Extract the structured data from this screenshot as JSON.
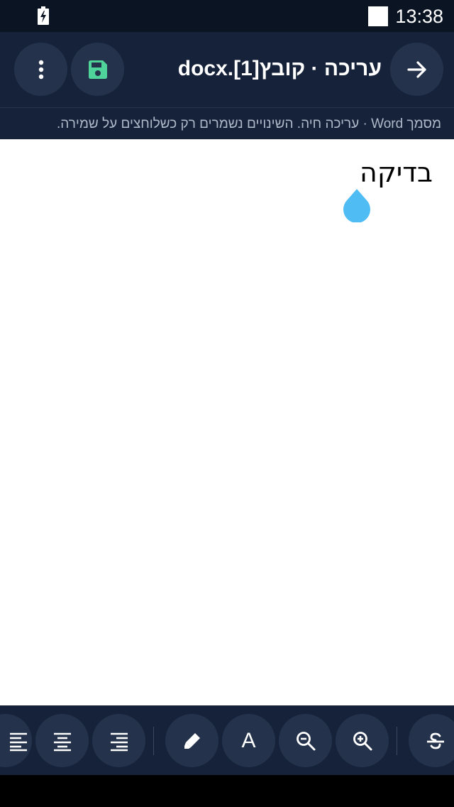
{
  "status_bar": {
    "time": "13:38",
    "battery_icon": "battery-charging-icon"
  },
  "app_bar": {
    "title": "עריכה · קובץ[1].docx",
    "back_icon": "arrow-right-icon",
    "save_icon": "save-icon",
    "menu_icon": "more-vert-icon"
  },
  "subtitle": "מסמך Word · עריכה חיה. השינויים נשמרים רק כשלוחצים על שמירה.",
  "document": {
    "text": "בדיקה"
  },
  "toolbar": {
    "items": [
      "strikethrough-icon",
      "zoom-in-icon",
      "zoom-out-icon",
      "font-icon",
      "highlight-icon",
      "align-right-icon",
      "align-center-icon",
      "align-left-icon"
    ],
    "font_glyph": "A"
  },
  "colors": {
    "bar_background": "#15223a",
    "button_background": "#24324b",
    "save_accent": "#4fd39a",
    "cursor_handle": "#4fbdf3"
  }
}
